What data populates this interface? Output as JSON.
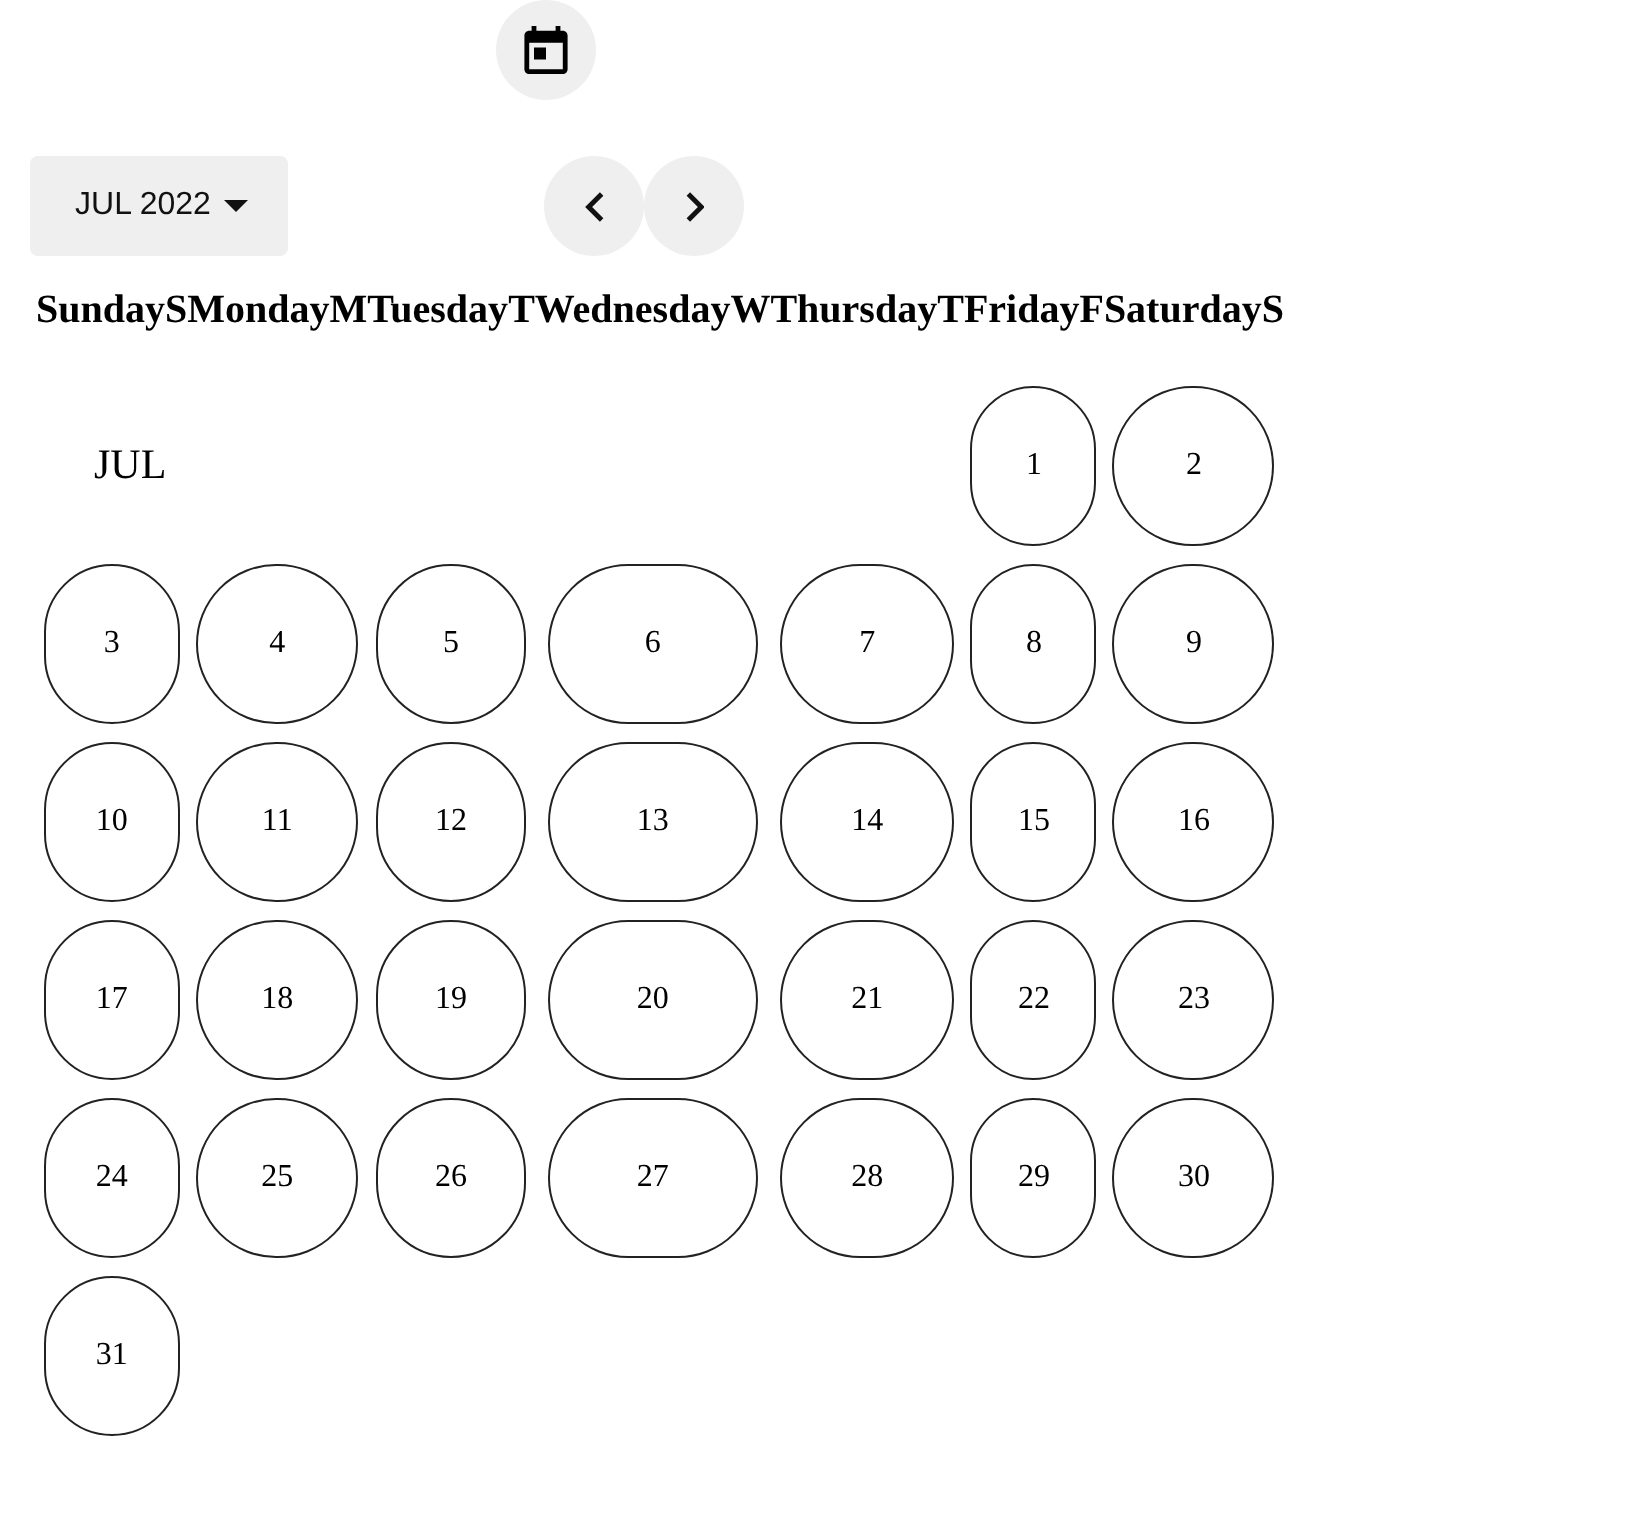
{
  "toolbar": {
    "month_button": {
      "label": "JUL 2022"
    }
  },
  "weekdays": [
    {
      "name": "Sunday",
      "short": "S"
    },
    {
      "name": "Monday",
      "short": "M"
    },
    {
      "name": "Tuesday",
      "short": "T"
    },
    {
      "name": "Wednesday",
      "short": "W"
    },
    {
      "name": "Thursday",
      "short": "T"
    },
    {
      "name": "Friday",
      "short": "F"
    },
    {
      "name": "Saturday",
      "short": "S"
    }
  ],
  "weeks": [
    {
      "label": "JUL",
      "days": [
        "1",
        "2"
      ]
    },
    {
      "days": [
        "3",
        "4",
        "5",
        "6",
        "7",
        "8",
        "9"
      ]
    },
    {
      "days": [
        "10",
        "11",
        "12",
        "13",
        "14",
        "15",
        "16"
      ]
    },
    {
      "days": [
        "17",
        "18",
        "19",
        "20",
        "21",
        "22",
        "23"
      ]
    },
    {
      "days": [
        "24",
        "25",
        "26",
        "27",
        "28",
        "29",
        "30"
      ]
    },
    {
      "days": [
        "31"
      ]
    }
  ]
}
